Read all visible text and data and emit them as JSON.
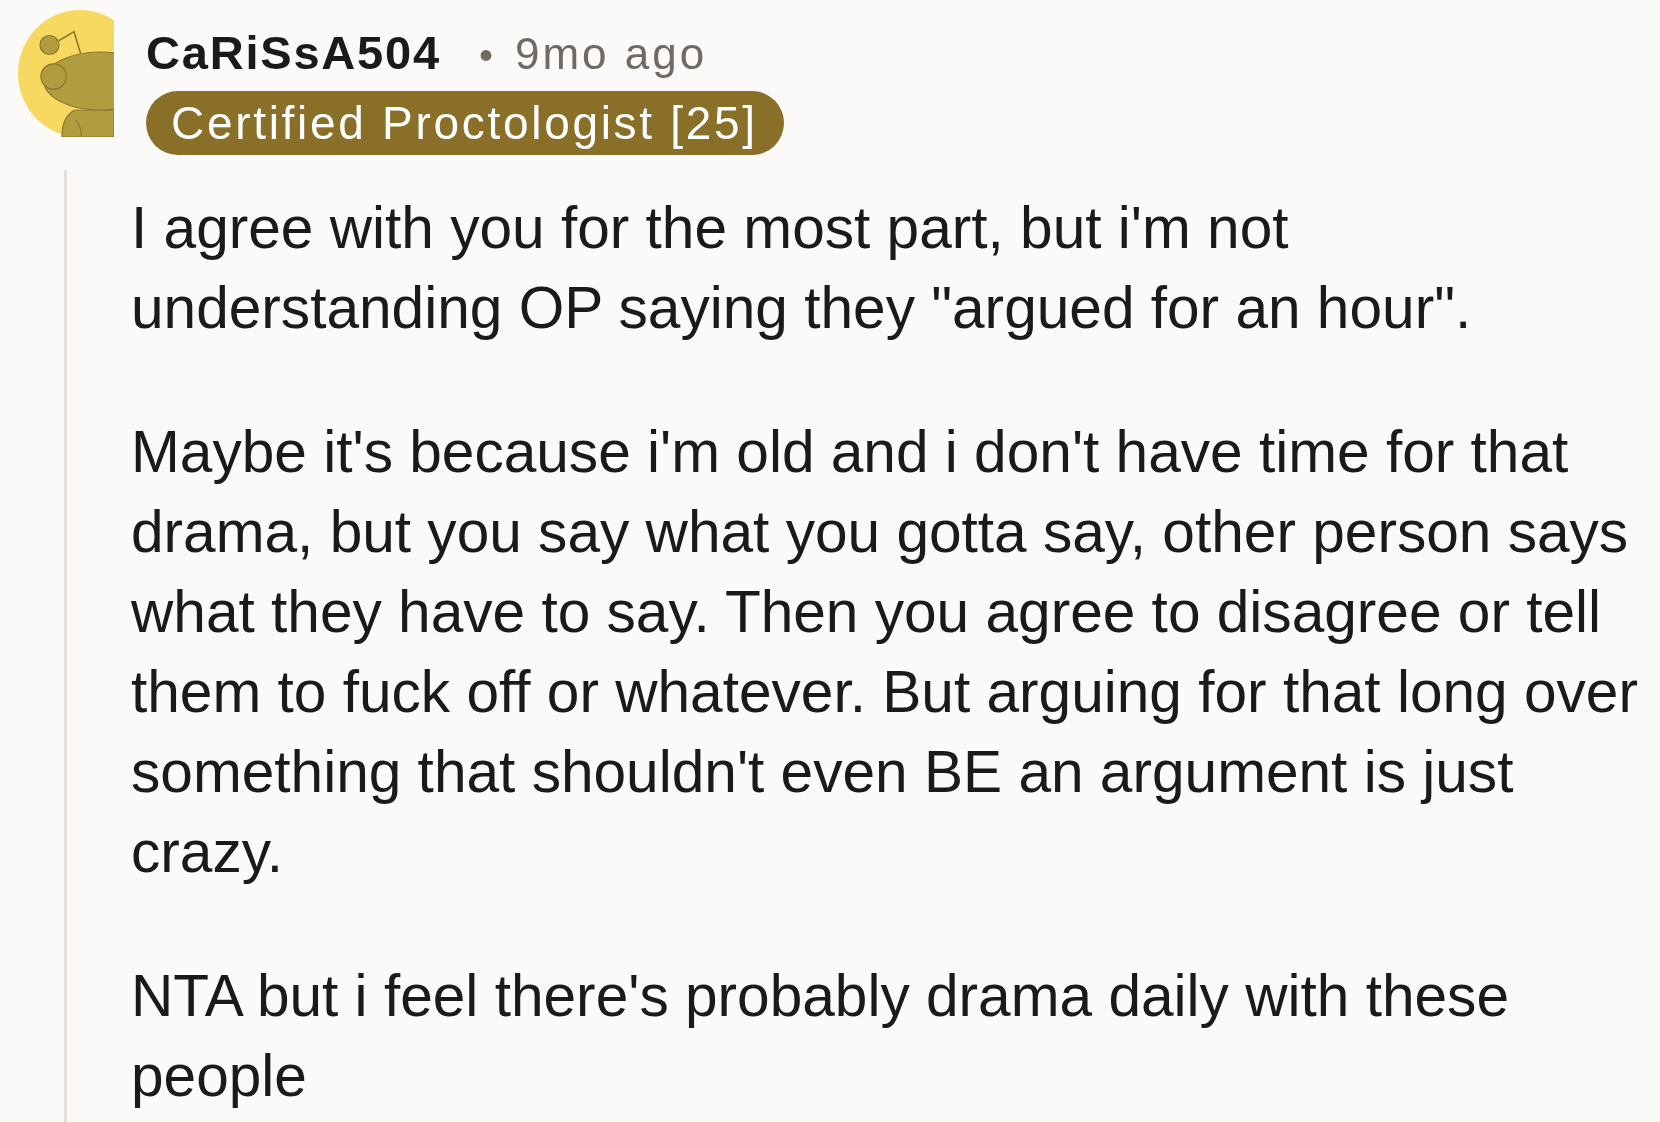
{
  "comment": {
    "author": "CaRiSsA504",
    "separator": "•",
    "time": "9mo ago",
    "flair": "Certified Proctologist [25]",
    "body": [
      "I agree with you for the most part, but i'm not understanding OP saying they \"argued for an hour\".",
      "Maybe it's because i'm old and i don't have time for that drama, but you say what you gotta say, other person says what they have to say. Then you agree to disagree or tell them to fuck off or whatever. But arguing for that long over something that shouldn't even BE an argument is just crazy.",
      "NTA but i feel there's probably drama daily with these people"
    ]
  }
}
